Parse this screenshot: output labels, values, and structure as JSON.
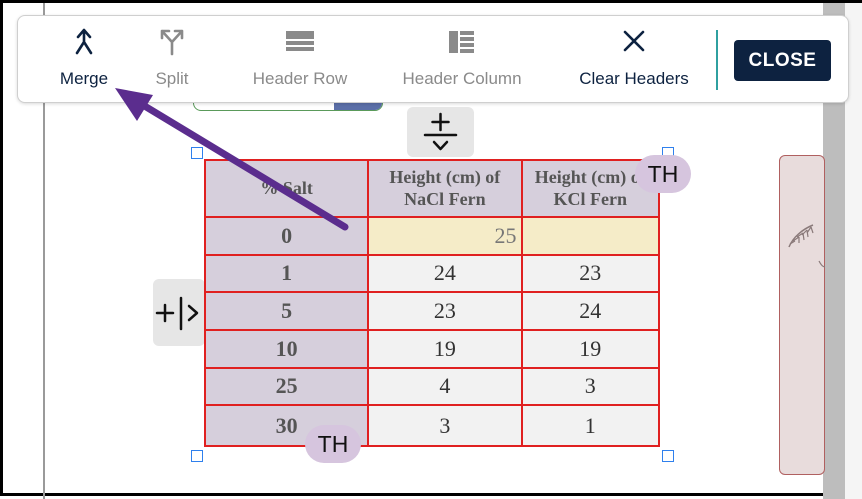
{
  "toolbar": {
    "merge_label": "Merge",
    "split_label": "Split",
    "header_row_label": "Header Row",
    "header_column_label": "Header Column",
    "clear_headers_label": "Clear Headers",
    "close_label": "CLOSE"
  },
  "table": {
    "header": [
      "% Salt",
      "Height (cm) of NaCl Fern",
      "Height (cm) of KCl Fern"
    ],
    "rows": [
      [
        "0",
        "25",
        ""
      ],
      [
        "1",
        "24",
        "23"
      ],
      [
        "5",
        "23",
        "24"
      ],
      [
        "10",
        "19",
        "19"
      ],
      [
        "25",
        "4",
        "3"
      ],
      [
        "30",
        "3",
        "1"
      ]
    ]
  },
  "badges": {
    "row_header": "TH",
    "column_header": "TH"
  },
  "colors": {
    "primary": "#0d2240",
    "cell_border": "#e02020",
    "header_fill": "#d6cfdc",
    "selected_fill": "#f5ecc8",
    "annotation_arrow": "#5b2d8e",
    "handle": "#2f80ed"
  }
}
